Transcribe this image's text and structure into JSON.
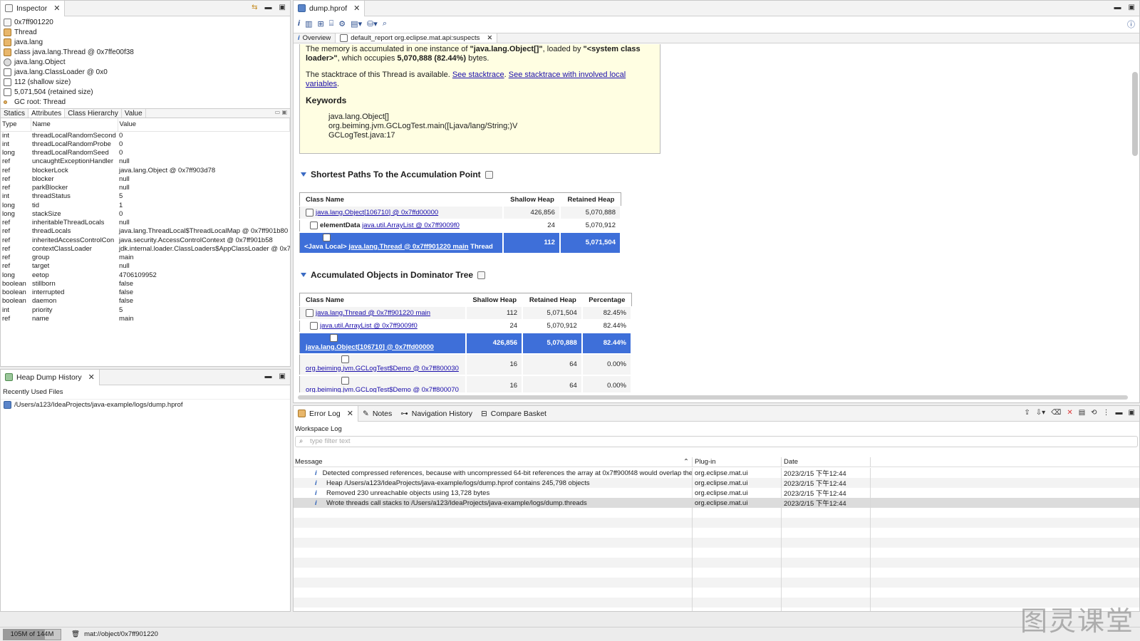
{
  "inspector": {
    "tab_label": "Inspector",
    "lines": [
      {
        "icon": "at-icon",
        "text": "0x7ff901220"
      },
      {
        "icon": "thread-icon",
        "text": "Thread"
      },
      {
        "icon": "package-icon",
        "text": "java.lang"
      },
      {
        "icon": "class-icon",
        "text": "class java.lang.Thread @ 0x7ffe00f38"
      },
      {
        "icon": "superclass-icon",
        "text": "java.lang.Object"
      },
      {
        "icon": "classloader-icon",
        "text": "java.lang.ClassLoader @ 0x0"
      },
      {
        "icon": "size-icon",
        "text": "112 (shallow size)"
      },
      {
        "icon": "size-icon",
        "text": "5,071,504 (retained size)"
      },
      {
        "icon": "gcroot-icon",
        "text": "GC root: Thread"
      }
    ],
    "subtabs": [
      "Statics",
      "Attributes",
      "Class Hierarchy",
      "Value"
    ],
    "active_subtab": "Attributes",
    "columns": [
      "Type",
      "Name",
      "Value"
    ],
    "rows": [
      [
        "int",
        "threadLocalRandomSecond",
        "0"
      ],
      [
        "int",
        "threadLocalRandomProbe",
        "0"
      ],
      [
        "long",
        "threadLocalRandomSeed",
        "0"
      ],
      [
        "ref",
        "uncaughtExceptionHandler",
        "null"
      ],
      [
        "ref",
        "blockerLock",
        "java.lang.Object @ 0x7ff903d78"
      ],
      [
        "ref",
        "blocker",
        "null"
      ],
      [
        "ref",
        "parkBlocker",
        "null"
      ],
      [
        "int",
        "threadStatus",
        "5"
      ],
      [
        "long",
        "tid",
        "1"
      ],
      [
        "long",
        "stackSize",
        "0"
      ],
      [
        "ref",
        "inheritableThreadLocals",
        "null"
      ],
      [
        "ref",
        "threadLocals",
        "java.lang.ThreadLocal$ThreadLocalMap @ 0x7ff901b80"
      ],
      [
        "ref",
        "inheritedAccessControlCon",
        "java.security.AccessControlContext @ 0x7ff901b58"
      ],
      [
        "ref",
        "contextClassLoader",
        "jdk.internal.loader.ClassLoaders$AppClassLoader @ 0x7"
      ],
      [
        "ref",
        "group",
        "main"
      ],
      [
        "ref",
        "target",
        "null"
      ],
      [
        "long",
        "eetop",
        "4706109952"
      ],
      [
        "boolean",
        "stillborn",
        "false"
      ],
      [
        "boolean",
        "interrupted",
        "false"
      ],
      [
        "boolean",
        "daemon",
        "false"
      ],
      [
        "int",
        "priority",
        "5"
      ],
      [
        "ref",
        "name",
        "main"
      ]
    ]
  },
  "history": {
    "tab_label": "Heap Dump History",
    "section_label": "Recently Used Files",
    "files": [
      "/Users/a123/IdeaProjects/java-example/logs/dump.hprof"
    ]
  },
  "editor": {
    "tab_label": "dump.hprof",
    "report_tabs": [
      "Overview",
      "default_report  org.eclipse.mat.api:suspects"
    ],
    "box": {
      "line1_pre": "The memory is accumulated in one instance of ",
      "line1_bold": "\"java.lang.Object[]\"",
      "line1_mid": ", loaded by ",
      "line1_bold2": "\"<system class loader>\"",
      "line1_mid2": ", which occupies ",
      "line1_bold3": "5,070,888 (82.44%)",
      "line1_post": " bytes.",
      "stack_pre": "The stacktrace of this Thread is available. ",
      "link1": "See stacktrace",
      "link2": "See stacktrace with involved local variables",
      "keywords_title": "Keywords",
      "keywords": [
        "java.lang.Object[]",
        "org.beiming.jvm.GCLogTest.main([Ljava/lang/String;)V",
        "GCLogTest.java:17"
      ]
    },
    "paths": {
      "title": "Shortest Paths To the Accumulation Point",
      "columns": [
        "Class Name",
        "Shallow Heap",
        "Retained Heap"
      ],
      "rows": [
        {
          "prefix": "",
          "name": "java.lang.Object[106710] @ 0x7ffd00000",
          "suffix": "",
          "shallow": "426,856",
          "retained": "5,070,888"
        },
        {
          "prefix": "elementData",
          "name": "java.util.ArrayList @ 0x7ff9009f0",
          "suffix": "",
          "shallow": "24",
          "retained": "5,070,912"
        },
        {
          "prefix": "<Java Local>",
          "name": "java.lang.Thread @ 0x7ff901220 main",
          "suffix": "Thread",
          "shallow": "112",
          "retained": "5,071,504"
        }
      ]
    },
    "dominator": {
      "title": "Accumulated Objects in Dominator Tree",
      "columns": [
        "Class Name",
        "Shallow Heap",
        "Retained Heap",
        "Percentage"
      ],
      "rows": [
        {
          "name": "java.lang.Thread @ 0x7ff901220 main",
          "shallow": "112",
          "retained": "5,071,504",
          "pct": "82.45%"
        },
        {
          "name": "java.util.ArrayList @ 0x7ff9009f0",
          "shallow": "24",
          "retained": "5,070,912",
          "pct": "82.44%"
        },
        {
          "name": "java.lang.Object[106710] @ 0x7ffd00000",
          "shallow": "426,856",
          "retained": "5,070,888",
          "pct": "82.44%"
        },
        {
          "name": "org.beiming.jvm.GCLogTest$Demo @ 0x7ff800030",
          "shallow": "16",
          "retained": "64",
          "pct": "0.00%"
        },
        {
          "name": "org.beiming.jvm.GCLogTest$Demo @ 0x7ff800070",
          "shallow": "16",
          "retained": "64",
          "pct": "0.00%"
        }
      ]
    }
  },
  "log": {
    "tabs": [
      "Error Log",
      "Notes",
      "Navigation History",
      "Compare Basket"
    ],
    "workspace_label": "Workspace Log",
    "filter_placeholder": "type filter text",
    "columns": [
      "Message",
      "Plug-in",
      "Date"
    ],
    "rows": [
      {
        "message": "Detected compressed references, because with uncompressed 64-bit references the array at 0x7ff900f48 would overlap the",
        "plugin": "org.eclipse.mat.ui",
        "date": "2023/2/15 下午12:44"
      },
      {
        "message": "Heap /Users/a123/IdeaProjects/java-example/logs/dump.hprof contains 245,798 objects",
        "plugin": "org.eclipse.mat.ui",
        "date": "2023/2/15 下午12:44"
      },
      {
        "message": "Removed 230 unreachable objects using 13,728 bytes",
        "plugin": "org.eclipse.mat.ui",
        "date": "2023/2/15 下午12:44"
      },
      {
        "message": "Wrote threads call stacks to /Users/a123/IdeaProjects/java-example/logs/dump.threads",
        "plugin": "org.eclipse.mat.ui",
        "date": "2023/2/15 下午12:44"
      }
    ]
  },
  "status": {
    "memory": "105M of 144M",
    "memory_fraction": 0.73,
    "path": "mat://object/0x7ff901220"
  },
  "watermark": "图灵课堂"
}
